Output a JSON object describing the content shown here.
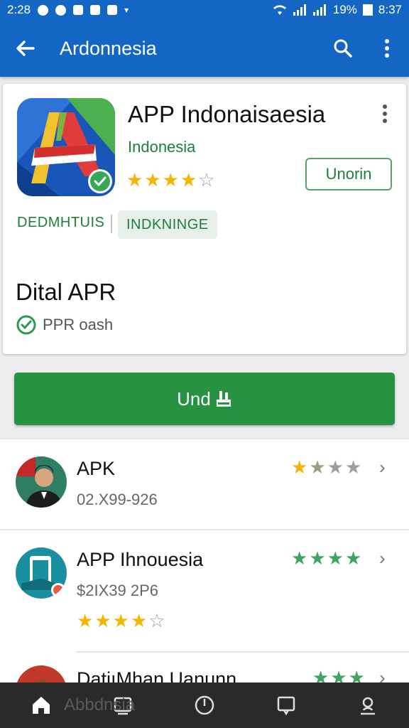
{
  "status_bar": {
    "time_left": "2:28",
    "battery": "19%",
    "time_right": "8:37"
  },
  "app_bar": {
    "title": "Ardonnesia",
    "back_icon": "arrow-left-icon",
    "search_icon": "search-icon",
    "more_icon": "more-vert-icon"
  },
  "app_card": {
    "app_name": "APP Indonaisaesia",
    "developer": "Indonesia",
    "rating_stars": 4,
    "update_chip": "Unorin",
    "tags": [
      "DEDMHTUIS",
      "INDKNINGE"
    ],
    "section_title": "Dital APR",
    "check_text": "PPR oash",
    "colors": {
      "accent_green": "#1e7e3b",
      "primary_blue": "#1466c4"
    }
  },
  "main_button": {
    "label": "Und"
  },
  "list": {
    "items": [
      {
        "title": "APK",
        "subtitle": "02.X99-926",
        "rating": 1,
        "star_style": "mixed"
      },
      {
        "title": "APP Ihnouesia",
        "subtitle": "$2IX39 2P6",
        "rating": 4,
        "star_style": "green",
        "inline_rating": 4
      },
      {
        "title": "DatiıMhan Uanunn",
        "subtitle": "",
        "star_style": "green"
      }
    ]
  },
  "nav_bar": {
    "home_ghost_label": "Abbdnsia",
    "icons": [
      "home-icon",
      "recents-icon",
      "power-icon",
      "chat-icon",
      "account-icon"
    ]
  }
}
